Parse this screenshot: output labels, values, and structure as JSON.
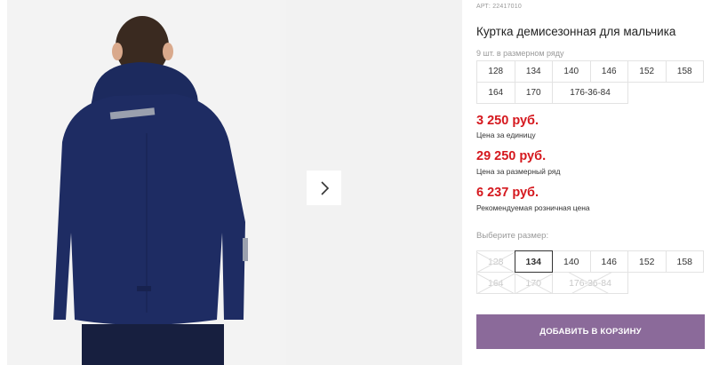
{
  "gallery": {
    "next_icon": "chevron-right-icon"
  },
  "product": {
    "sku": "АРТ: 22417010",
    "title": "Куртка демисезонная для мальчика",
    "row_count_text": "9 шт. в размерном ряду",
    "size_row": [
      "128",
      "134",
      "140",
      "146",
      "152",
      "158",
      "164",
      "170",
      "176-36-84"
    ],
    "prices": [
      {
        "amount": "3 250 руб.",
        "note": "Цена за единицу"
      },
      {
        "amount": "29 250 руб.",
        "note": "Цена за размерный ряд"
      },
      {
        "amount": "6 237 руб.",
        "note": "Рекомендуемая розничная цена"
      }
    ],
    "price_color": "#d5181e"
  },
  "size_select": {
    "label": "Выберите размер:",
    "options": [
      {
        "label": "128",
        "state": "disabled"
      },
      {
        "label": "134",
        "state": "selected"
      },
      {
        "label": "140",
        "state": "available"
      },
      {
        "label": "146",
        "state": "available"
      },
      {
        "label": "152",
        "state": "available"
      },
      {
        "label": "158",
        "state": "available"
      },
      {
        "label": "164",
        "state": "disabled"
      },
      {
        "label": "170",
        "state": "disabled"
      },
      {
        "label": "176-36-84",
        "state": "disabled"
      }
    ]
  },
  "cart": {
    "button_label": "ДОБАВИТЬ В КОРЗИНУ",
    "button_color": "#8b6a9a"
  }
}
